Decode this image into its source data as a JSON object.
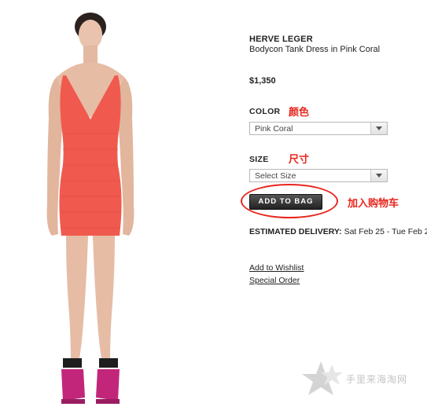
{
  "product": {
    "brand": "HERVE LEGER",
    "name": "Bodycon Tank Dress in Pink Coral",
    "price": "$1,350"
  },
  "color": {
    "label": "COLOR",
    "annotation": "颜色",
    "selected": "Pink Coral"
  },
  "size": {
    "label": "SIZE",
    "annotation": "尺寸",
    "selected": "Select Size"
  },
  "cart": {
    "button_label": "ADD TO BAG",
    "annotation": "加入购物车"
  },
  "delivery": {
    "label": "ESTIMATED DELIVERY:",
    "value": "Sat Feb 25 - Tue Feb 2"
  },
  "links": {
    "wishlist": "Add to Wishlist",
    "special_order": "Special Order"
  },
  "watermark": {
    "text": "手里来海淘网"
  },
  "colors": {
    "dress": "#f05a4e",
    "annotation": "#e8261c",
    "button": "#333333"
  }
}
